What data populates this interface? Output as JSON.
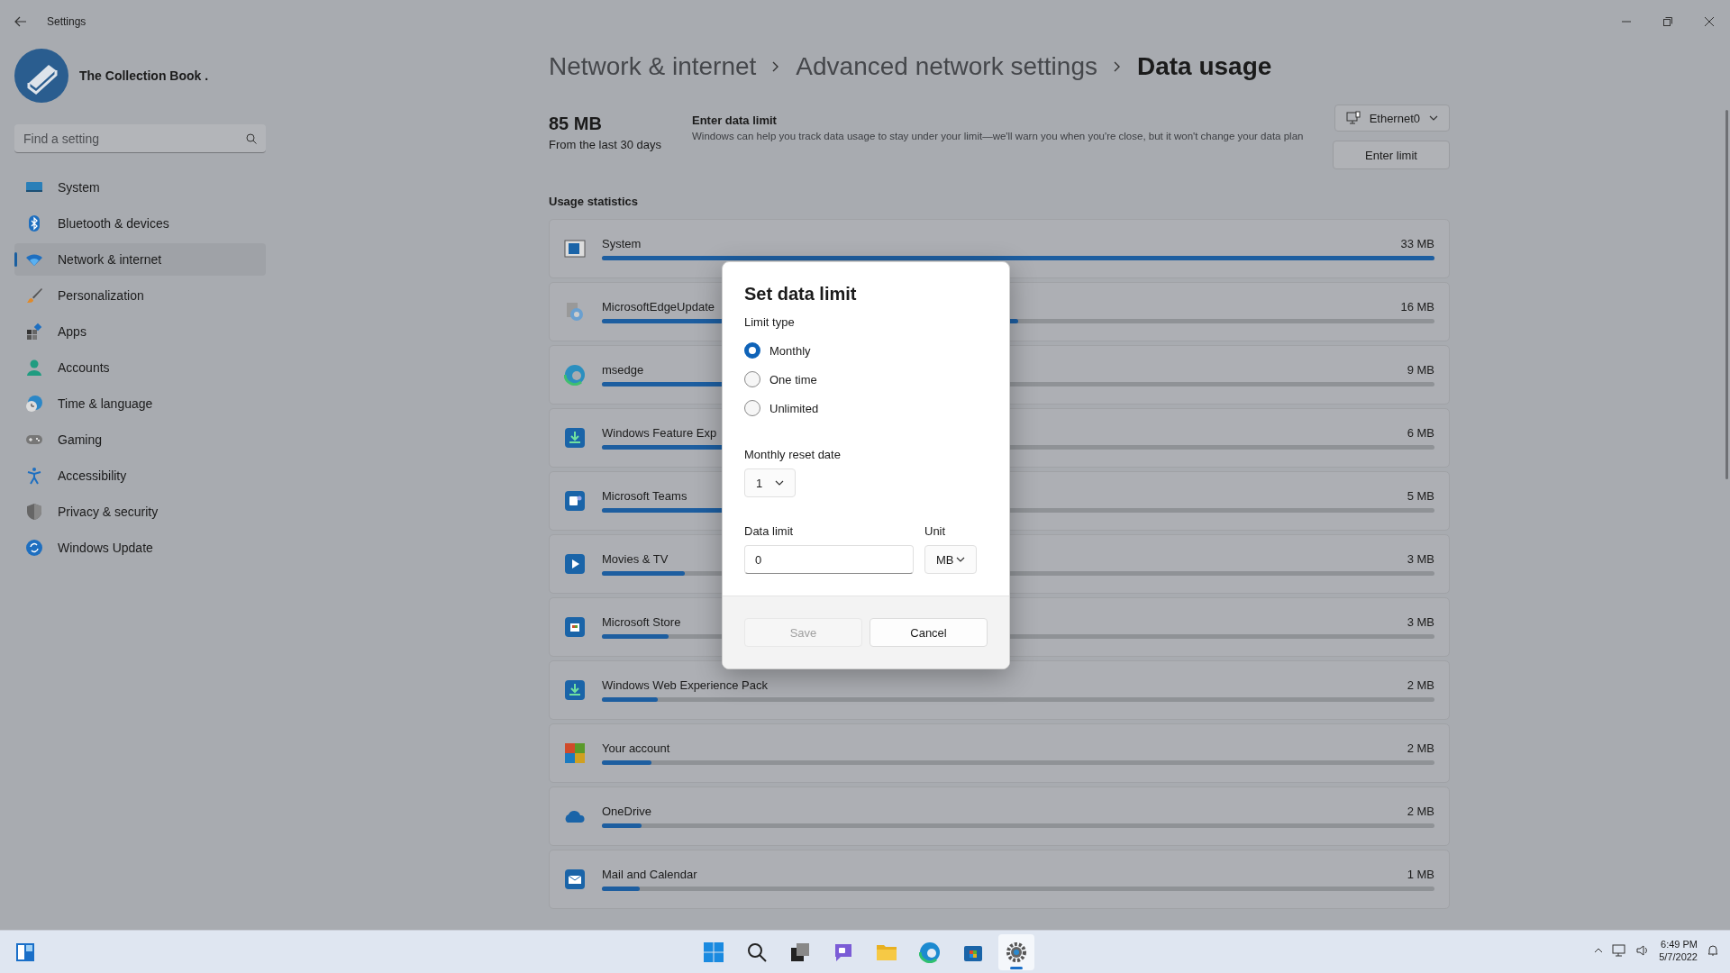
{
  "window": {
    "title": "Settings"
  },
  "sidebar": {
    "profile_name": "The Collection Book .",
    "search": {
      "placeholder": "Find a setting"
    },
    "items": [
      {
        "label": "System",
        "selected": false
      },
      {
        "label": "Bluetooth & devices",
        "selected": false
      },
      {
        "label": "Network & internet",
        "selected": true
      },
      {
        "label": "Personalization",
        "selected": false
      },
      {
        "label": "Apps",
        "selected": false
      },
      {
        "label": "Accounts",
        "selected": false
      },
      {
        "label": "Time & language",
        "selected": false
      },
      {
        "label": "Gaming",
        "selected": false
      },
      {
        "label": "Accessibility",
        "selected": false
      },
      {
        "label": "Privacy & security",
        "selected": false
      },
      {
        "label": "Windows Update",
        "selected": false
      }
    ]
  },
  "breadcrumb": [
    "Network & internet",
    "Advanced network settings",
    "Data usage"
  ],
  "summary": {
    "amount": "85 MB",
    "period": "From the last 30 days"
  },
  "data_limit": {
    "title": "Enter data limit",
    "description": "Windows can help you track data usage to stay under your limit—we'll warn you when you're close, but it won't change your data plan"
  },
  "network_dropdown": {
    "value": "Ethernet0"
  },
  "enter_limit_button": "Enter limit",
  "usage_heading": "Usage statistics",
  "apps": [
    {
      "name": "System",
      "usage": "33 MB",
      "level": 1
    },
    {
      "name": "MicrosoftEdgeUpdate",
      "usage": "16 MB",
      "level": 0.5
    },
    {
      "name": "msedge",
      "usage": "9 MB",
      "level": 0.27
    },
    {
      "name": "Windows Feature Exp",
      "usage": "6 MB",
      "level": 0.18
    },
    {
      "name": "Microsoft Teams",
      "usage": "5 MB",
      "level": 0.15
    },
    {
      "name": "Movies & TV",
      "usage": "3 MB",
      "level": 0.1
    },
    {
      "name": "Microsoft Store",
      "usage": "3 MB",
      "level": 0.08
    },
    {
      "name": "Windows Web Experience Pack",
      "usage": "2 MB",
      "level": 0.067
    },
    {
      "name": "Your account",
      "usage": "2 MB",
      "level": 0.06
    },
    {
      "name": "OneDrive",
      "usage": "2 MB",
      "level": 0.048
    },
    {
      "name": "Mail and Calendar",
      "usage": "1 MB",
      "level": 0.045
    }
  ],
  "dialog": {
    "title": "Set data limit",
    "limit_type_label": "Limit type",
    "options": [
      {
        "label": "Monthly",
        "selected": true
      },
      {
        "label": "One time",
        "selected": false
      },
      {
        "label": "Unlimited",
        "selected": false
      }
    ],
    "reset_label": "Monthly reset date",
    "reset_value": "1",
    "data_limit_label": "Data limit",
    "data_limit_value": "0",
    "unit_label": "Unit",
    "unit_value": "MB",
    "buttons": [
      {
        "label": "Save",
        "disabled": true
      },
      {
        "label": "Cancel",
        "disabled": false
      }
    ]
  },
  "taskbar": {
    "icons": [
      {
        "selected": false
      },
      {
        "selected": false
      },
      {
        "selected": false
      },
      {
        "selected": false
      },
      {
        "selected": false
      },
      {
        "selected": false
      },
      {
        "selected": false
      },
      {
        "selected": true
      }
    ],
    "time": "6:49 PM",
    "date": "5/7/2022"
  }
}
